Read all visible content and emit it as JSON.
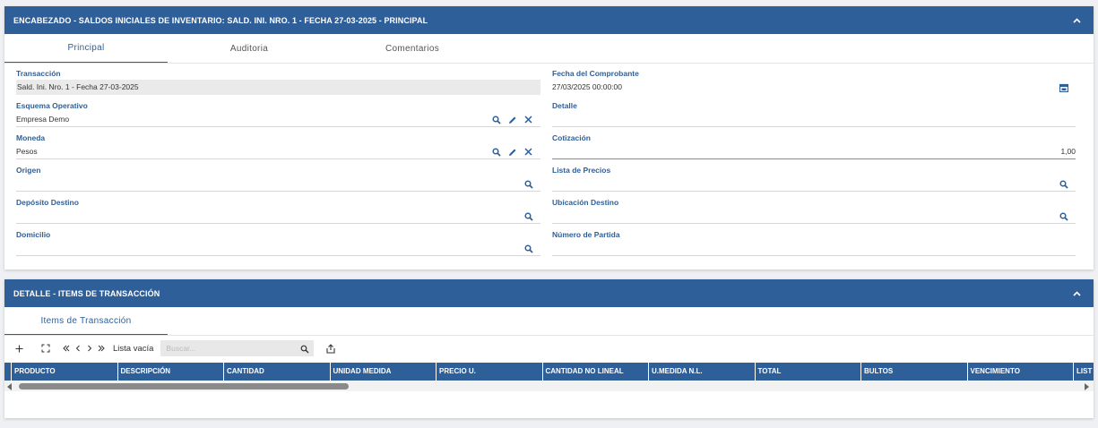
{
  "header_panel": {
    "title": "ENCABEZADO - SALDOS INICIALES DE INVENTARIO: SALD. INI. NRO. 1 - FECHA 27-03-2025 - PRINCIPAL",
    "tabs": [
      "Principal",
      "Auditoria",
      "Comentarios"
    ],
    "fields": {
      "transaccion": {
        "label": "Transacción",
        "value": "Sald. Ini. Nro.  1 - Fecha 27-03-2025"
      },
      "fecha": {
        "label": "Fecha del Comprobante",
        "value": "27/03/2025 00:00:00"
      },
      "esquema": {
        "label": "Esquema Operativo",
        "value": "Empresa Demo"
      },
      "detalle": {
        "label": "Detalle",
        "value": ""
      },
      "moneda": {
        "label": "Moneda",
        "value": "Pesos"
      },
      "cotizacion": {
        "label": "Cotización",
        "value": "1,00"
      },
      "origen": {
        "label": "Origen",
        "value": ""
      },
      "lista_precios": {
        "label": "Lista de Precios",
        "value": ""
      },
      "deposito": {
        "label": "Depósito Destino",
        "value": ""
      },
      "ubicacion": {
        "label": "Ubicación Destino",
        "value": ""
      },
      "domicilio": {
        "label": "Domicilio",
        "value": ""
      },
      "partida": {
        "label": "Número de Partida",
        "value": ""
      }
    }
  },
  "detail_panel": {
    "title": "DETALLE - ITEMS DE TRANSACCIÓN",
    "tab": "Items de Transacción",
    "toolbar": {
      "status": "Lista vacía",
      "search_placeholder": "Buscar..."
    },
    "columns": [
      "PRODUCTO",
      "DESCRIPCIÓN",
      "CANTIDAD",
      "UNIDAD MEDIDA",
      "PRECIO U.",
      "CANTIDAD NO LINEAL",
      "U.MEDIDA N.L.",
      "TOTAL",
      "BULTOS",
      "VENCIMIENTO",
      "LIST"
    ]
  },
  "colors": {
    "primary": "#2e5f99"
  },
  "icons": [
    "chevron-up-icon",
    "search-icon",
    "edit-icon",
    "clear-icon",
    "calendar-icon",
    "add-icon",
    "expand-icon",
    "first-page-icon",
    "prev-page-icon",
    "next-page-icon",
    "last-page-icon",
    "export-icon"
  ]
}
